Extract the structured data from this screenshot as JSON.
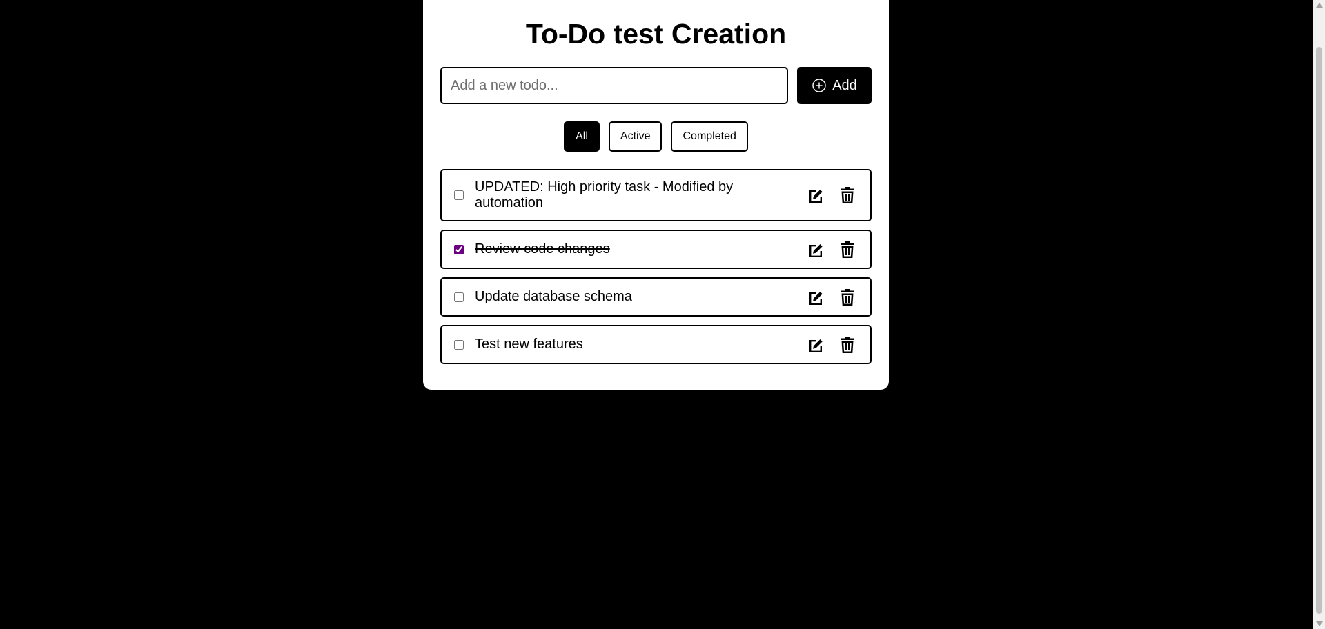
{
  "app": {
    "title": "To-Do test Creation"
  },
  "new_todo": {
    "placeholder": "Add a new todo...",
    "value": "",
    "add_label": "Add",
    "add_icon": "plus-circle-icon"
  },
  "filters": [
    {
      "label": "All",
      "active": true
    },
    {
      "label": "Active",
      "active": false
    },
    {
      "label": "Completed",
      "active": false
    }
  ],
  "todos": [
    {
      "text": "UPDATED: High priority task - Modified by automation",
      "completed": false
    },
    {
      "text": "Review code changes",
      "completed": true
    },
    {
      "text": "Update database schema",
      "completed": false
    },
    {
      "text": "Test new features",
      "completed": false
    }
  ],
  "icons": {
    "edit": "edit-icon",
    "delete": "trash-icon"
  },
  "colors": {
    "background": "#000000",
    "card": "#ffffff",
    "accent": "#000000",
    "checkbox_checked": "#6a0080"
  }
}
